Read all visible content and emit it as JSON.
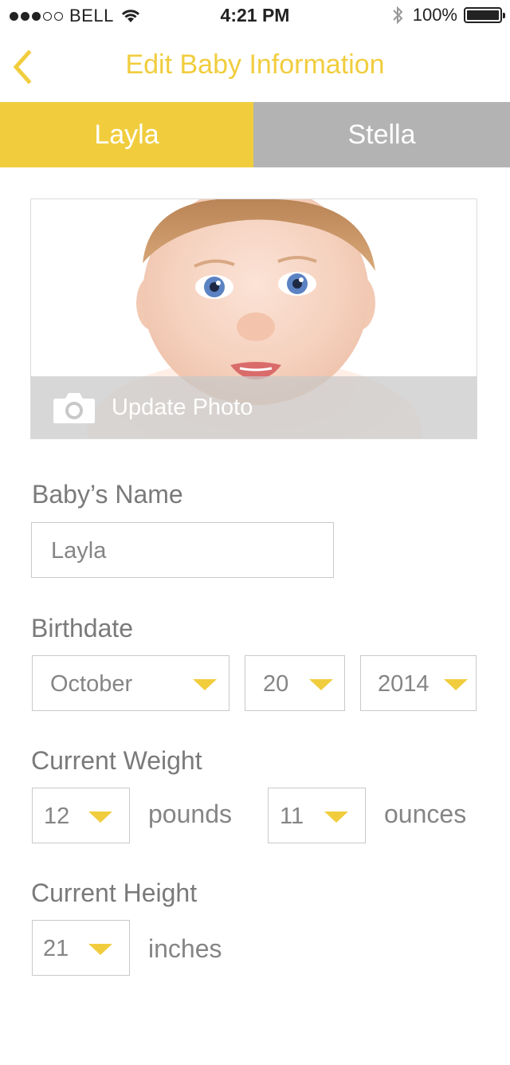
{
  "status_bar": {
    "carrier": "BELL",
    "time": "4:21 PM",
    "battery": "100%"
  },
  "nav": {
    "title": "Edit Baby Information"
  },
  "tabs": [
    {
      "label": "Layla",
      "active": true
    },
    {
      "label": "Stella",
      "active": false
    }
  ],
  "photo": {
    "update_label": "Update Photo"
  },
  "name_section": {
    "label": "Baby’s Name",
    "value": "Layla"
  },
  "birthdate": {
    "label": "Birthdate",
    "month": "October",
    "day": "20",
    "year": "2014"
  },
  "weight": {
    "label": "Current Weight",
    "pounds_value": "12",
    "pounds_unit": "pounds",
    "ounces_value": "11",
    "ounces_unit": "ounces"
  },
  "height": {
    "label": "Current Height",
    "value": "21",
    "unit": "inches"
  },
  "colors": {
    "accent": "#f1cd3e",
    "inactive_tab": "#b3b3b3"
  }
}
